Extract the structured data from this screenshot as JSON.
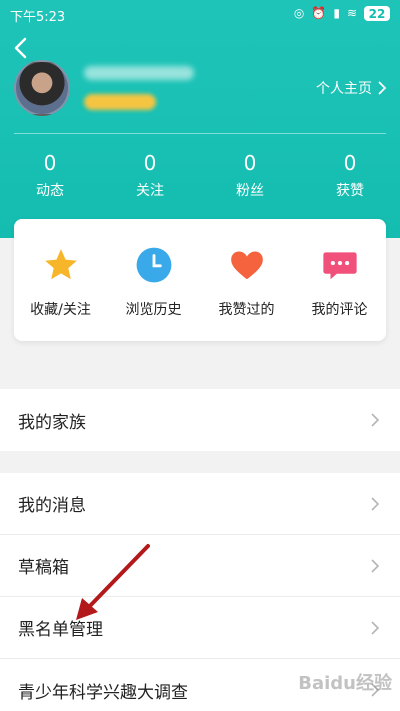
{
  "status_bar": {
    "time": "下午5:23",
    "battery": "22"
  },
  "profile": {
    "homepage_link": "个人主页"
  },
  "stats": [
    {
      "value": "0",
      "label": "动态"
    },
    {
      "value": "0",
      "label": "关注"
    },
    {
      "value": "0",
      "label": "粉丝"
    },
    {
      "value": "0",
      "label": "获赞"
    }
  ],
  "quick_actions": [
    {
      "label": "收藏/关注",
      "icon": "star-icon",
      "color": "#f7b62a"
    },
    {
      "label": "浏览历史",
      "icon": "clock-icon",
      "color": "#3aa9ea"
    },
    {
      "label": "我赞过的",
      "icon": "heart-icon",
      "color": "#f5633e"
    },
    {
      "label": "我的评论",
      "icon": "comment-icon",
      "color": "#f0507a"
    }
  ],
  "menu_group1": [
    {
      "label": "我的家族"
    }
  ],
  "menu_group2": [
    {
      "label": "我的消息"
    },
    {
      "label": "草稿箱"
    },
    {
      "label": "黑名单管理"
    },
    {
      "label": "青少年科学兴趣大调查"
    }
  ],
  "watermark": "Baidu经验",
  "colors": {
    "header": "#14bdb0",
    "annotation_arrow": "#b3191b"
  }
}
